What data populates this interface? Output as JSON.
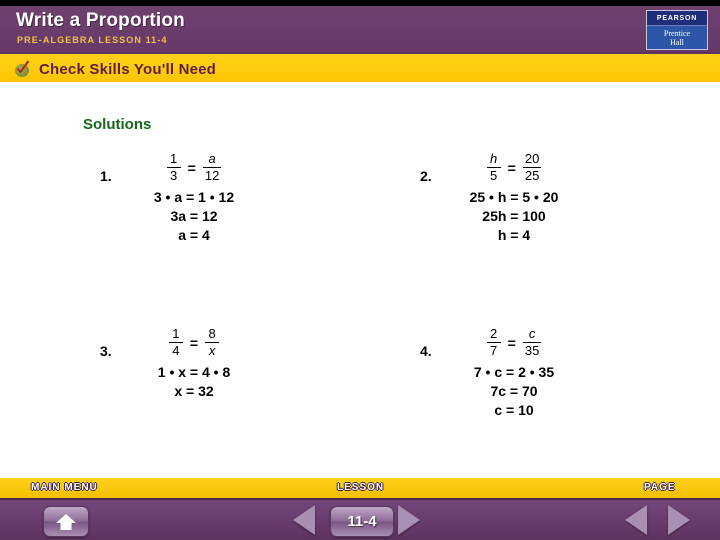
{
  "header": {
    "title": "Write a Proportion",
    "subtitle": "PRE-ALGEBRA LESSON 11-4",
    "logo": {
      "brand": "PEARSON",
      "imprint_line1": "Prentice",
      "imprint_line2": "Hall"
    }
  },
  "check_bar": {
    "icon": "check-mark-icon",
    "label": "Check Skills You'll Need"
  },
  "content": {
    "heading": "Solutions",
    "problems": [
      {
        "number": "1.",
        "equation": {
          "left": {
            "numerator": "1",
            "denominator": "3",
            "num_italic": false,
            "den_italic": false
          },
          "operator": "=",
          "right": {
            "numerator": "a",
            "denominator": "12",
            "num_italic": true,
            "den_italic": false
          }
        },
        "steps": [
          "3 • a = 1 • 12",
          "3a = 12",
          "a = 4"
        ]
      },
      {
        "number": "2.",
        "equation": {
          "left": {
            "numerator": "h",
            "denominator": "5",
            "num_italic": true,
            "den_italic": false
          },
          "operator": "=",
          "right": {
            "numerator": "20",
            "denominator": "25",
            "num_italic": false,
            "den_italic": false
          }
        },
        "steps": [
          "25 • h = 5 • 20",
          "25h = 100",
          "h = 4"
        ]
      },
      {
        "number": "3.",
        "equation": {
          "left": {
            "numerator": "1",
            "denominator": "4",
            "num_italic": false,
            "den_italic": false
          },
          "operator": "=",
          "right": {
            "numerator": "8",
            "denominator": "x",
            "num_italic": false,
            "den_italic": true
          }
        },
        "steps": [
          "1 • x = 4 • 8",
          "x = 32"
        ]
      },
      {
        "number": "4.",
        "equation": {
          "left": {
            "numerator": "2",
            "denominator": "7",
            "num_italic": false,
            "den_italic": false
          },
          "operator": "=",
          "right": {
            "numerator": "c",
            "denominator": "35",
            "num_italic": true,
            "den_italic": false
          }
        },
        "steps": [
          "7 • c = 2 • 35",
          "7c = 70",
          "c = 10"
        ]
      }
    ]
  },
  "footer": {
    "main_menu_label": "MAIN MENU",
    "lesson_label": "LESSON",
    "page_label": "PAGE",
    "lesson_number": "11-4",
    "home_icon": "home-icon",
    "lesson_prev_icon": "triangle-left-icon",
    "lesson_next_icon": "triangle-right-icon",
    "page_prev_icon": "triangle-left-icon",
    "page_next_icon": "triangle-right-icon"
  },
  "colors": {
    "header_purple": "#6B3D6B",
    "accent_yellow": "#FFCC00",
    "heading_green": "#17681E",
    "check_label_maroon": "#5E1F3C",
    "logo_blue": "#2C3E8F"
  }
}
